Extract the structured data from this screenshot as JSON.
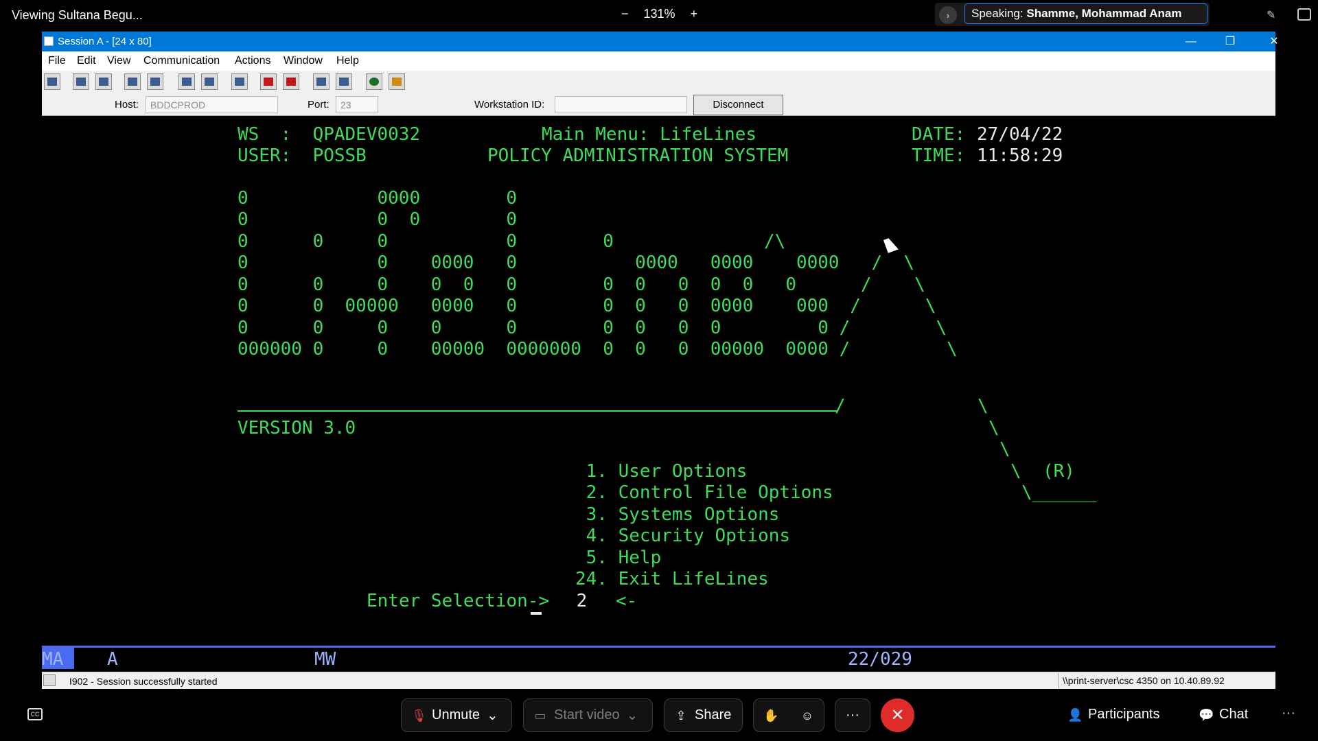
{
  "meeting": {
    "viewing": "Viewing Sultana Begu...",
    "zoom_minus": "−",
    "zoom_level": "131%",
    "zoom_plus": "+",
    "speaking_label": "Speaking:",
    "speaking_name": "Shamme, Mohammad Anam"
  },
  "window": {
    "title": "Session A - [24 x 80]",
    "minimize": "—",
    "restore": "❐",
    "close": "✕"
  },
  "menu": [
    "File",
    "Edit",
    "View",
    "Communication",
    "Actions",
    "Window",
    "Help"
  ],
  "host": {
    "host_label": "Host:",
    "host_value": "BDDCPROD",
    "port_label": "Port:",
    "port_value": "23",
    "ws_label": "Workstation ID:",
    "ws_value": "",
    "disconnect": "Disconnect"
  },
  "terminal": {
    "ws_line": "WS  :  QPADEV0032",
    "main_menu": "Main Menu: LifeLines",
    "date_label": "DATE:",
    "date_value": "27/04/22",
    "user_line": "USER:  POSSB",
    "system_name": "POLICY ADMINISTRATION SYSTEM",
    "time_label": "TIME:",
    "time_value": "11:58:29",
    "logo": [
      "0            0000        0",
      "0            0  0        0",
      "0      0     0           0        0              /\\",
      "0            0    0000   0           0000   0000    0000   /  \\",
      "0      0     0    0  0   0        0  0   0  0  0   0      /    \\",
      "0      0  00000   0000   0        0  0   0  0000    000  /      \\",
      "0      0     0    0      0        0  0   0  0         0 /        \\",
      "000000 0     0    00000  0000000  0  0   0  00000  0000 /         \\"
    ],
    "logo_tail": [
      "/",
      "\\",
      "\\",
      "\\",
      "\\  (R)",
      "\\______"
    ],
    "version": "VERSION 3.0",
    "options": [
      " 1. User Options",
      " 2. Control File Options",
      " 3. Systems Options",
      " 4. Security Options",
      " 5. Help",
      "24. Exit LifeLines"
    ],
    "prompt": "Enter Selection->",
    "selection": " 2",
    "prompt_end": "<-"
  },
  "oia": {
    "ma": "MA",
    "a": "A",
    "mw": "MW",
    "position": "22/029"
  },
  "status": {
    "message": "I902 - Session successfully started",
    "printer": "\\\\print-server\\csc 4350 on 10.40.89.92"
  },
  "controls": {
    "unmute": "Unmute",
    "start_video": "Start video",
    "share": "Share",
    "participants": "Participants",
    "chat": "Chat",
    "more": "···",
    "end": "✕",
    "cc": "CC"
  }
}
